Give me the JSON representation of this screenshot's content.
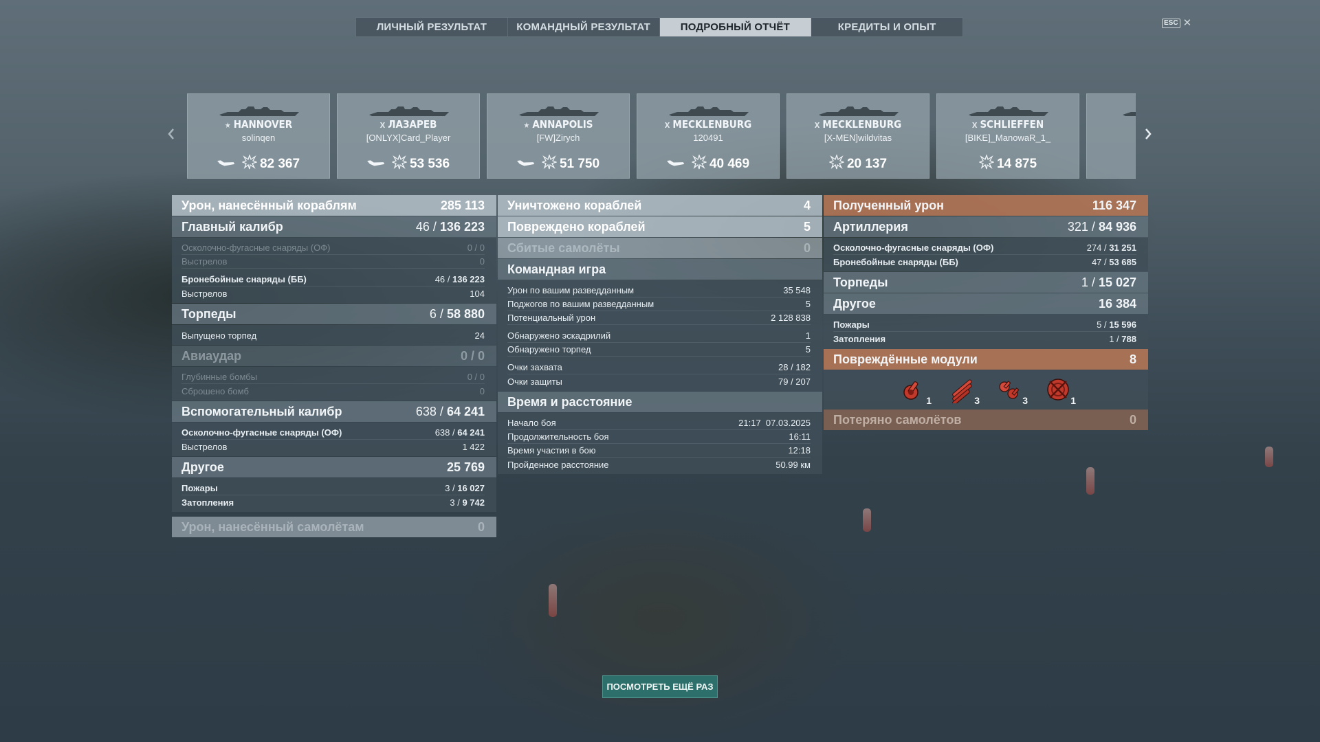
{
  "tabs": [
    {
      "label": "ЛИЧНЫЙ РЕЗУЛЬТАТ"
    },
    {
      "label": "КОМАНДНЫЙ РЕЗУЛЬТАТ"
    },
    {
      "label": "ПОДРОБНЫЙ ОТЧЁТ",
      "active": true
    },
    {
      "label": "КРЕДИТЫ И ОПЫТ"
    }
  ],
  "esc": {
    "key": "ESC",
    "close_glyph": "✕"
  },
  "ships": [
    {
      "tier": "★",
      "name": "HANNOVER",
      "player": "solinqen",
      "damage": "82 367",
      "aircraft_icon": true
    },
    {
      "tier": "X",
      "name": "ЛАЗАРЕВ",
      "player": "[ONLYX]Card_Player",
      "damage": "53 536",
      "aircraft_icon": true
    },
    {
      "tier": "★",
      "name": "ANNAPOLIS",
      "player": "[FW]Zirych",
      "damage": "51 750",
      "aircraft_icon": true
    },
    {
      "tier": "X",
      "name": "MECKLENBURG",
      "player": "120491",
      "damage": "40 469",
      "aircraft_icon": true
    },
    {
      "tier": "X",
      "name": "MECKLENBURG",
      "player": "[X-MEN]wildvitas",
      "damage": "20 137",
      "aircraft_icon": false
    },
    {
      "tier": "X",
      "name": "SCHLIEFFEN",
      "player": "[BIKE]_ManowaR_1_",
      "damage": "14 875",
      "aircraft_icon": false
    }
  ],
  "left": {
    "damage_ships": {
      "label": "Урон, нанесённый кораблям",
      "value": "285 113"
    },
    "main_battery": {
      "label": "Главный калибр",
      "pre": "46 / ",
      "value": "136 223"
    },
    "main_rows": [
      {
        "label": "Осколочно-фугасные снаряды (ОФ)",
        "value": "0 / 0"
      },
      {
        "label": "Выстрелов",
        "value": "0"
      },
      {
        "label": "Бронебойные снаряды (ББ)",
        "pre": "46 / ",
        "value": "136 223"
      },
      {
        "label": "Выстрелов",
        "value": "104"
      }
    ],
    "torpedoes": {
      "label": "Торпеды",
      "pre": "6 / ",
      "value": "58 880"
    },
    "torp_rows": [
      {
        "label": "Выпущено торпед",
        "value": "24"
      }
    ],
    "air_strike": {
      "label": "Авиаудар",
      "value": "0 / 0"
    },
    "air_rows": [
      {
        "label": "Глубинные бомбы",
        "value": "0 / 0"
      },
      {
        "label": "Сброшено бомб",
        "value": "0"
      }
    ],
    "secondary": {
      "label": "Вспомогательный калибр",
      "pre": "638 / ",
      "value": "64 241"
    },
    "sec_rows": [
      {
        "label": "Осколочно-фугасные снаряды (ОФ)",
        "pre": "638 / ",
        "value": "64 241"
      },
      {
        "label": "Выстрелов",
        "value": "1 422"
      }
    ],
    "other": {
      "label": "Другое",
      "value": "25 769"
    },
    "other_rows": [
      {
        "label": "Пожары",
        "pre": "3 / ",
        "value": "16 027"
      },
      {
        "label": "Затопления",
        "pre": "3 / ",
        "value": "9 742"
      }
    ],
    "damage_planes": {
      "label": "Урон, нанесённый самолётам",
      "value": "0"
    }
  },
  "middle": {
    "destroyed": {
      "label": "Уничтожено кораблей",
      "value": "4"
    },
    "damaged": {
      "label": "Повреждено кораблей",
      "value": "5"
    },
    "planes_shot": {
      "label": "Сбитые самолёты",
      "value": "0"
    },
    "team_play": {
      "label": "Командная игра"
    },
    "team_rows_1": [
      {
        "label": "Урон по вашим разведданным",
        "value": "35 548"
      },
      {
        "label": "Поджогов по вашим разведданным",
        "value": "5"
      },
      {
        "label": "Потенциальный урон",
        "value": "2 128 838"
      }
    ],
    "team_rows_2": [
      {
        "label": "Обнаружено эскадрилий",
        "value": "1"
      },
      {
        "label": "Обнаружено торпед",
        "value": "5"
      }
    ],
    "team_rows_3": [
      {
        "label": "Очки захвата",
        "value": "28 / 182"
      },
      {
        "label": "Очки защиты",
        "value": "79 / 207"
      }
    ],
    "time_distance": {
      "label": "Время и расстояние"
    },
    "time_rows": [
      {
        "label": "Начало боя",
        "value": "21:17  07.03.2025"
      },
      {
        "label": "Продолжительность боя",
        "value": "16:11"
      },
      {
        "label": "Время участия в бою",
        "value": "12:18"
      },
      {
        "label": "Пройденное расстояние",
        "value": "50.99 км"
      }
    ]
  },
  "right": {
    "received": {
      "label": "Полученный урон",
      "value": "116 347"
    },
    "artillery": {
      "label": "Артиллерия",
      "pre": "321 / ",
      "value": "84 936"
    },
    "art_rows": [
      {
        "label": "Осколочно-фугасные снаряды (ОФ)",
        "pre": "274 / ",
        "value": "31 251"
      },
      {
        "label": "Бронебойные снаряды (ББ)",
        "pre": "47 / ",
        "value": "53 685"
      }
    ],
    "torpedoes": {
      "label": "Торпеды",
      "pre": "1 / ",
      "value": "15 027"
    },
    "other": {
      "label": "Другое",
      "value": "16 384"
    },
    "other_rows": [
      {
        "label": "Пожары",
        "pre": "5 / ",
        "value": "15 596"
      },
      {
        "label": "Затопления",
        "pre": "1 / ",
        "value": "788"
      }
    ],
    "modules": {
      "label": "Повреждённые модули",
      "value": "8"
    },
    "module_items": [
      {
        "icon": "main-battery-module-icon",
        "count": "1"
      },
      {
        "icon": "torpedo-tube-module-icon",
        "count": "3"
      },
      {
        "icon": "secondary-battery-module-icon",
        "count": "3"
      },
      {
        "icon": "steering-gear-module-icon",
        "count": "1"
      }
    ],
    "planes_lost": {
      "label": "Потеряно самолётов",
      "value": "0"
    }
  },
  "replay_button": "ПОСМОТРЕТЬ ЕЩЁ РАЗ",
  "colors": {
    "accent_orange": "#b07456",
    "active_tab": "#c6ced3",
    "button_teal": "#2d6f6a"
  }
}
